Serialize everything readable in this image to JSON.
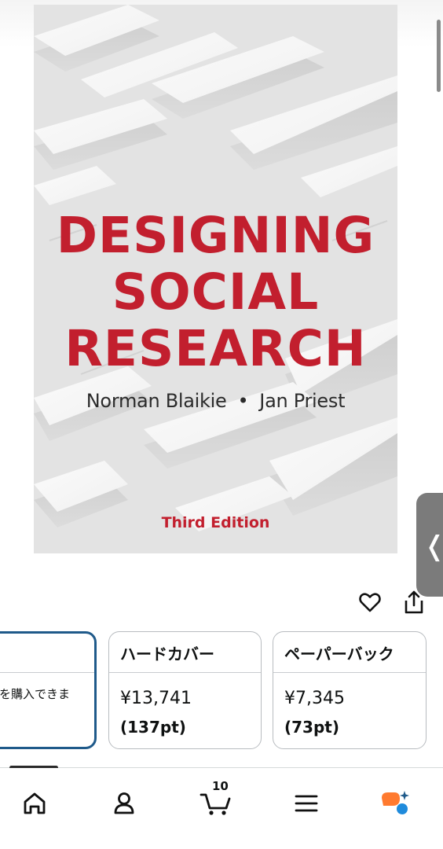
{
  "product": {
    "cover": {
      "title_lines": [
        "DESIGNING",
        "SOCIAL",
        "RESEARCH"
      ],
      "author_1": "Norman Blaikie",
      "separator": "•",
      "author_2": "Jan Priest",
      "edition": "Third Edition",
      "title_color": "#c21f2e"
    }
  },
  "actions": {
    "wishlist_icon": "heart-icon",
    "share_icon": "share-icon"
  },
  "formats": [
    {
      "header": "",
      "description": "を購入できま",
      "selected": true
    },
    {
      "header": "ハードカバー",
      "price": "¥13,741",
      "points": "(137pt)",
      "selected": false
    },
    {
      "header": "ペーパーバック",
      "price": "¥7,345",
      "points": "(73pt)",
      "selected": false
    }
  ],
  "side_panel": {
    "icon": "chevron-left-icon",
    "glyph": "❬"
  },
  "bottom_nav": {
    "items": [
      "home-icon",
      "account-icon",
      "cart-icon",
      "menu-icon",
      "rufus-icon"
    ],
    "cart_count": "10"
  },
  "colors": {
    "selected_border": "#1f5a8a",
    "rufus_orange": "#ff7a2f",
    "rufus_blue": "#1f8bdc"
  }
}
